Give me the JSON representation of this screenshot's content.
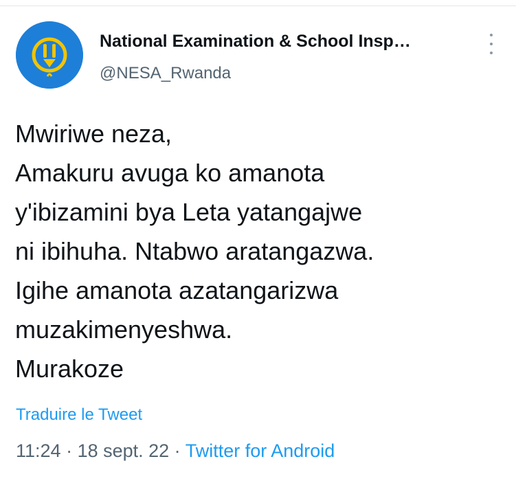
{
  "tweet": {
    "author": {
      "display_name": "National Examination & School Insp…",
      "handle": "@NESA_Rwanda",
      "avatar_icon": "nesa-logo-icon",
      "avatar_color": "#1e7fd8"
    },
    "more_icon": "vertical-ellipsis-icon",
    "lines": [
      "Mwiriwe neza,",
      "Amakuru avuga ko amanota",
      "y'ibizamini bya Leta yatangajwe",
      "ni ibihuha. Ntabwo aratangazwa.",
      "Igihe amanota azatangarizwa",
      "muzakimenyeshwa.",
      "Murakoze"
    ],
    "translate_label": "Traduire le Tweet",
    "time": "11:24",
    "separator": " · ",
    "date": "18 sept. 22",
    "source": "Twitter for Android"
  },
  "colors": {
    "link": "#1d9bf0",
    "secondary_text": "#536471",
    "primary_text": "#0f1419"
  }
}
